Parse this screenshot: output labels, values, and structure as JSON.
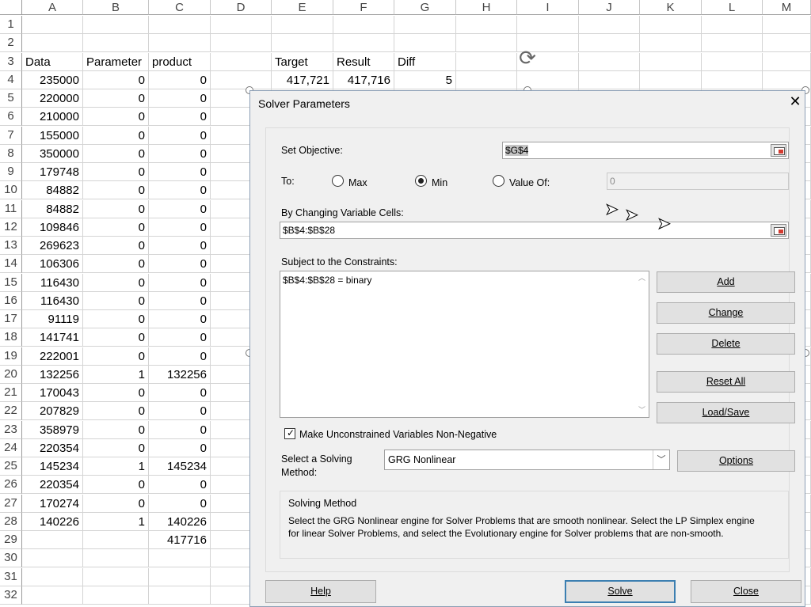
{
  "columns": [
    "A",
    "B",
    "C",
    "D",
    "E",
    "F",
    "G",
    "H",
    "I",
    "J",
    "K",
    "L",
    "M"
  ],
  "rows": [
    "1",
    "2",
    "3",
    "4",
    "5",
    "6",
    "7",
    "8",
    "9",
    "10",
    "11",
    "12",
    "13",
    "14",
    "15",
    "16",
    "17",
    "18",
    "19",
    "20",
    "21",
    "22",
    "23",
    "24",
    "25",
    "26",
    "27",
    "28",
    "29",
    "30",
    "31",
    "32"
  ],
  "headers": {
    "data": "Data",
    "parameter": "Parameter",
    "product": "product",
    "target": "Target",
    "result": "Result",
    "diff": "Diff"
  },
  "summary": {
    "target": "417,721",
    "result": "417,716",
    "diff": "5"
  },
  "table": [
    [
      "235000",
      "0",
      "0"
    ],
    [
      "220000",
      "0",
      "0"
    ],
    [
      "210000",
      "0",
      "0"
    ],
    [
      "155000",
      "0",
      "0"
    ],
    [
      "350000",
      "0",
      "0"
    ],
    [
      "179748",
      "0",
      "0"
    ],
    [
      "84882",
      "0",
      "0"
    ],
    [
      "84882",
      "0",
      "0"
    ],
    [
      "109846",
      "0",
      "0"
    ],
    [
      "269623",
      "0",
      "0"
    ],
    [
      "106306",
      "0",
      "0"
    ],
    [
      "116430",
      "0",
      "0"
    ],
    [
      "116430",
      "0",
      "0"
    ],
    [
      "91119",
      "0",
      "0"
    ],
    [
      "141741",
      "0",
      "0"
    ],
    [
      "222001",
      "0",
      "0"
    ],
    [
      "132256",
      "1",
      "132256"
    ],
    [
      "170043",
      "0",
      "0"
    ],
    [
      "207829",
      "0",
      "0"
    ],
    [
      "358979",
      "0",
      "0"
    ],
    [
      "220354",
      "0",
      "0"
    ],
    [
      "145234",
      "1",
      "145234"
    ],
    [
      "220354",
      "0",
      "0"
    ],
    [
      "170274",
      "0",
      "0"
    ],
    [
      "140226",
      "1",
      "140226"
    ]
  ],
  "total": "417716",
  "dialog": {
    "title": "Solver Parameters",
    "close": "✕",
    "set_objective_label": "Set Objective:",
    "set_objective_value": "$G$4",
    "to_label": "To:",
    "max_label": "Max",
    "min_label": "Min",
    "value_of_label": "Value Of:",
    "value_of_value": "0",
    "changing_label": "By Changing Variable Cells:",
    "changing_value": "$B$4:$B$28",
    "constraints_label": "Subject to the Constraints:",
    "constraints": [
      "$B$4:$B$28 = binary"
    ],
    "add": "Add",
    "change": "Change",
    "delete": "Delete",
    "reset_all": "Reset All",
    "load_save": "Load/Save",
    "nonneg_label": "Make Unconstrained Variables Non-Negative",
    "solving_label_1": "Select a Solving",
    "solving_label_2": "Method:",
    "solving_method": "GRG Nonlinear",
    "options": "Options",
    "group_title": "Solving Method",
    "group_text": "Select the GRG Nonlinear engine for Solver Problems that are smooth nonlinear. Select the LP Simplex engine for linear Solver Problems, and select the Evolutionary engine for Solver problems that are non-smooth.",
    "help": "Help",
    "solve": "Solve",
    "close_btn": "Close"
  }
}
